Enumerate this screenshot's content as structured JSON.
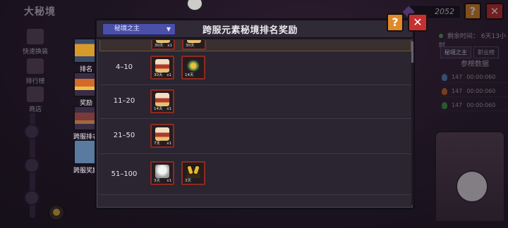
{
  "background": {
    "title": "大秘境",
    "nav": [
      {
        "label": "快速换装"
      },
      {
        "label": "排行榜"
      },
      {
        "label": "商店"
      }
    ],
    "currency_value": "2052",
    "help_symbol": "?",
    "close_symbol": "✕",
    "remaining_label": "剩余时间：",
    "remaining_value": "6天13小时",
    "right_tabs": [
      "秘境之主",
      "职业榜"
    ],
    "right_header": "参榜数据",
    "right_rows": [
      {
        "value": "147",
        "time": "00:00:060",
        "flame_color": "#5a8ac8"
      },
      {
        "value": "147",
        "time": "00:00:060",
        "flame_color": "#d06a2a"
      },
      {
        "value": "147",
        "time": "00:00:060",
        "flame_color": "#4a9a4a"
      }
    ]
  },
  "modal": {
    "select_value": "秘境之主",
    "select_caret": "▼",
    "title": "跨服元素秘境排名奖励",
    "help_symbol": "?",
    "close_symbol": "✕",
    "rows": [
      {
        "rank": "",
        "items": [
          {
            "icon": "champion-chest",
            "duration": "30天",
            "qty": "x1"
          },
          {
            "icon": "champion-chest",
            "duration": "30天",
            "qty": ""
          }
        ]
      },
      {
        "rank": "4–10",
        "items": [
          {
            "icon": "champion-chest",
            "duration": "30天",
            "qty": "x1"
          },
          {
            "icon": "element-orb",
            "duration": "14天",
            "qty": ""
          }
        ]
      },
      {
        "rank": "11–20",
        "items": [
          {
            "icon": "champion-chest",
            "duration": "14天",
            "qty": "x1"
          }
        ]
      },
      {
        "rank": "21–50",
        "items": [
          {
            "icon": "champion-chest",
            "duration": "7天",
            "qty": "x1"
          }
        ]
      },
      {
        "rank": "51–100",
        "items": [
          {
            "icon": "ghost-mask",
            "duration": "3天",
            "qty": "x1"
          },
          {
            "icon": "golden-horns",
            "duration": "3天",
            "qty": ""
          }
        ]
      }
    ]
  },
  "side_tabs": [
    {
      "label": "排名",
      "icon": "trophy-icon",
      "active": false
    },
    {
      "label": "奖励",
      "icon": "chest-icon",
      "active": false
    },
    {
      "label": "跨服排名",
      "icon": "chest-icon",
      "active": false
    },
    {
      "label": "跨服奖励",
      "icon": "gift-icon",
      "active": true
    }
  ]
}
